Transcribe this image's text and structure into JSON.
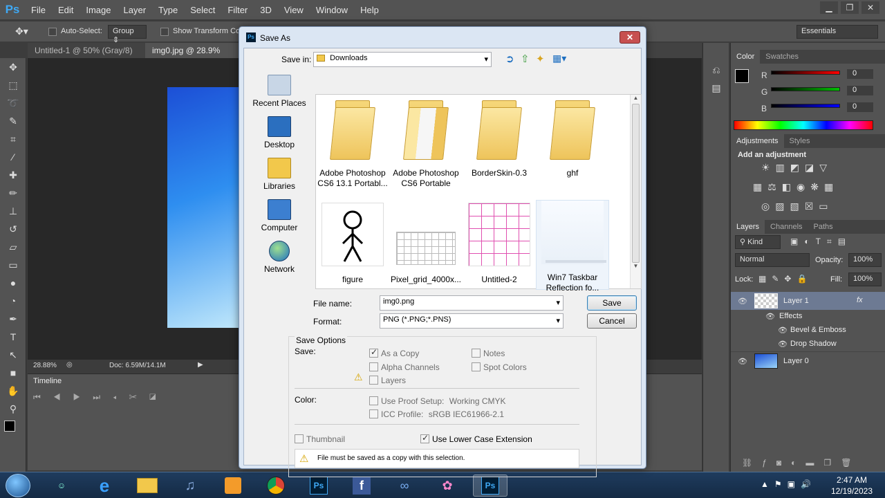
{
  "app": {
    "logo": "Ps"
  },
  "menu": [
    "File",
    "Edit",
    "Image",
    "Layer",
    "Type",
    "Select",
    "Filter",
    "3D",
    "View",
    "Window",
    "Help"
  ],
  "options": {
    "auto_select": "Auto-Select:",
    "group": "Group",
    "show_transform": "Show Transform Con",
    "workspace": "Essentials"
  },
  "doc_tabs": [
    {
      "label": "Untitled-1 @ 50% (Gray/8)",
      "close": "×"
    },
    {
      "label": "img0.jpg @ 28.9% (Laye"
    }
  ],
  "status": {
    "zoom": "28.88%",
    "doc": "Doc: 6.59M/14.1M"
  },
  "timeline": {
    "title": "Timeline"
  },
  "color_panel": {
    "tabs": [
      "Color",
      "Swatches"
    ],
    "channels": [
      {
        "label": "R",
        "value": "0",
        "color": "#ff0000"
      },
      {
        "label": "G",
        "value": "0",
        "color": "#00c000"
      },
      {
        "label": "B",
        "value": "0",
        "color": "#0000ff"
      }
    ]
  },
  "adjustments_panel": {
    "tabs": [
      "Adjustments",
      "Styles"
    ],
    "heading": "Add an adjustment"
  },
  "layers_panel": {
    "tabs": [
      "Layers",
      "Channels",
      "Paths"
    ],
    "kind": "Kind",
    "blend_mode": "Normal",
    "opacity_label": "Opacity:",
    "opacity": "100%",
    "lock_label": "Lock:",
    "fill_label": "Fill:",
    "fill": "100%",
    "layers": [
      {
        "name": "Layer 1",
        "fx": "fx"
      },
      {
        "name": "Effects"
      },
      {
        "name": "Bevel & Emboss"
      },
      {
        "name": "Drop Shadow"
      },
      {
        "name": "Layer 0"
      }
    ]
  },
  "dialog": {
    "title": "Save As",
    "close": "✕",
    "save_in_label": "Save in:",
    "save_in": "Downloads",
    "places": [
      "Recent Places",
      "Desktop",
      "Libraries",
      "Computer",
      "Network"
    ],
    "files": [
      {
        "name": "Adobe Photoshop CS6 13.1 Portabl...",
        "kind": "folder"
      },
      {
        "name": "Adobe Photoshop CS6 Portable",
        "kind": "folder"
      },
      {
        "name": "BorderSkin-0.3",
        "kind": "folder"
      },
      {
        "name": "ghf",
        "kind": "folder"
      },
      {
        "name": "figure",
        "kind": "image"
      },
      {
        "name": "Pixel_grid_4000x...",
        "kind": "image"
      },
      {
        "name": "Untitled-2",
        "kind": "image"
      },
      {
        "name": "Win7 Taskbar Reflection fo...",
        "kind": "image"
      }
    ],
    "file_name_label": "File name:",
    "file_name": "img0.png",
    "format_label": "Format:",
    "format": "PNG (*.PNG;*.PNS)",
    "save_button": "Save",
    "cancel_button": "Cancel",
    "save_options_title": "Save Options",
    "save_label": "Save:",
    "opt_as_copy": "As a Copy",
    "opt_notes": "Notes",
    "opt_alpha": "Alpha Channels",
    "opt_spot": "Spot Colors",
    "opt_layers": "Layers",
    "color_label": "Color:",
    "opt_proof": "Use Proof Setup:",
    "opt_proof_value": "Working CMYK",
    "opt_icc": "ICC Profile:",
    "opt_icc_value": "sRGB IEC61966-2.1",
    "opt_thumbnail": "Thumbnail",
    "opt_lowercase": "Use Lower Case Extension",
    "warning": "File must be saved as a copy with this selection."
  },
  "taskbar": {
    "time": "2:47 AM",
    "date": "12/19/2023"
  }
}
